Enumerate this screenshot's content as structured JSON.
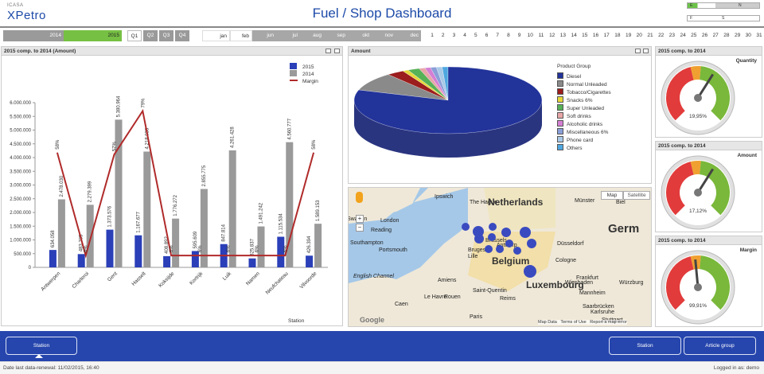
{
  "header": {
    "logo_small": "ICASA",
    "logo_big": "XPetro",
    "title": "Fuel / Shop Dashboard",
    "select_e": "E",
    "select_f": "F",
    "select_n": "N",
    "select_s": "S"
  },
  "filters": {
    "years": [
      "2014",
      "2015"
    ],
    "quarters": [
      "Q1",
      "Q2",
      "Q3",
      "Q4"
    ],
    "months": [
      "jan",
      "feb",
      "jun",
      "jul",
      "aug",
      "sep",
      "okt",
      "nov",
      "dec"
    ],
    "days": [
      "1",
      "2",
      "3",
      "4",
      "5",
      "6",
      "7",
      "8",
      "9",
      "10",
      "11",
      "12",
      "13",
      "14",
      "15",
      "16",
      "17",
      "18",
      "19",
      "20",
      "21",
      "22",
      "23",
      "24",
      "25",
      "26",
      "27",
      "28",
      "29",
      "30",
      "31"
    ]
  },
  "bar_panel": {
    "title": "2015 comp. to 2014 (Amount)",
    "station_label": "Station"
  },
  "pie_panel": {
    "title": "Amount",
    "legend_title": "Product Group"
  },
  "gauges": [
    {
      "title": "2015 comp. to 2014",
      "label": "Quantity",
      "value_text": "19,95%",
      "value": 0.1995
    },
    {
      "title": "2015 comp. to 2014",
      "label": "Amount",
      "value_text": "17,12%",
      "value": 0.1712
    },
    {
      "title": "2015 comp. to 2014",
      "label": "Margin",
      "value_text": "99,91%",
      "value": 0.9991
    }
  ],
  "map": {
    "map_btn": "Map",
    "satellite_btn": "Satellite",
    "labels": [
      "Ipswich",
      "The Hague",
      "Netherlands",
      "Münster",
      "Biel",
      "Swadon",
      "London",
      "Reading",
      "Bruges",
      "Antwerp",
      "Düsseldorf",
      "Southampton",
      "Portsmouth",
      "Brussels",
      "Lille",
      "Cologne",
      "Germ",
      "Belgium",
      "Frankfurt",
      "Wiesbaden",
      "Würzburg",
      "Mannheim",
      "Luxembourg",
      "Amiens",
      "Saint-Quentin",
      "Le Havre",
      "Rouen",
      "Reims",
      "Saarbrücken",
      "Caen",
      "Paris",
      "Karlsruhe",
      "Stuttgart",
      "English Channel"
    ],
    "footer": "Map Data   Terms of Use   Report a map error",
    "google": "Google"
  },
  "bottom": {
    "left_btn": "Station",
    "right_btn1": "Station",
    "right_btn2": "Article group"
  },
  "status": {
    "renewal": "Date last data-renewal: 11/02/2015, 16:40",
    "logged": "Logged in as: demo"
  },
  "chart_data": [
    {
      "type": "bar",
      "title": "2015 comp. to 2014 (Amount)",
      "xlabel": "Station",
      "categories": [
        "Antwerpen",
        "Charleroi",
        "Gent",
        "Hasselt",
        "Koksijde",
        "Kortrijk",
        "Luik",
        "Namen",
        "Neufchateau",
        "Vilvoorde"
      ],
      "series": [
        {
          "name": "2015",
          "color": "#2a3fb8",
          "values": [
            634058,
            483705,
            1373576,
            1167677,
            408892,
            595609,
            847814,
            325837,
            1115534,
            426394
          ]
        },
        {
          "name": "2014",
          "color": "#9a9a9a",
          "values": [
            2478030,
            2279399,
            5380964,
            4218033,
            1776272,
            2855775,
            4261428,
            1491242,
            4560777,
            1589153
          ]
        },
        {
          "name": "Margin",
          "color": "#b02a2a",
          "type": "line",
          "values": [
            58,
            6,
            57,
            79,
            6,
            6,
            6,
            6,
            6,
            58
          ],
          "labels": [
            "58%",
            "6%",
            "57%",
            "79%",
            "6%",
            "6%",
            "6%",
            "6%",
            "6%",
            "58%"
          ]
        }
      ],
      "bar_labels_2015": [
        "634.058",
        "483.705",
        "1.373.576",
        "1.167.677",
        "408.892",
        "595.609",
        "847.814",
        "325.837",
        "1.115.534",
        "426.394"
      ],
      "bar_labels_2014": [
        "2.478.030",
        "2.279.399",
        "5.380.964",
        "4.218.033",
        "1.776.272",
        "2.855.775",
        "4.261.428",
        "1.491.242",
        "4.560.777",
        "1.589.153"
      ],
      "y_ticks": [
        "0",
        "500.000",
        "1.000.000",
        "1.500.000",
        "2.000.000",
        "2.500.000",
        "3.000.000",
        "3.500.000",
        "4.000.000",
        "4.500.000",
        "5.000.000",
        "5.500.000",
        "6.000.000"
      ],
      "ylim": [
        0,
        6000000
      ],
      "legend": "top-right"
    },
    {
      "type": "pie",
      "title": "Amount",
      "legend_title": "Product Group",
      "categories": [
        "Diesel",
        "Normal Unleaded",
        "Tobacco/Cigarettes",
        "Snacks 6%",
        "Super Unleaded",
        "Soft drinks",
        "Alcoholic drinks",
        "Miscellaneous 6%",
        "Phone card",
        "Others"
      ],
      "values": [
        80,
        9,
        3,
        1,
        2,
        1,
        1,
        1,
        1,
        1
      ],
      "colors": [
        "#22339a",
        "#8a8a8a",
        "#9b1d1d",
        "#e6d83a",
        "#57b157",
        "#e8a6a6",
        "#d47fd4",
        "#8a9fd8",
        "#a9c9e6",
        "#4fa7e0"
      ],
      "legend": "right"
    }
  ]
}
